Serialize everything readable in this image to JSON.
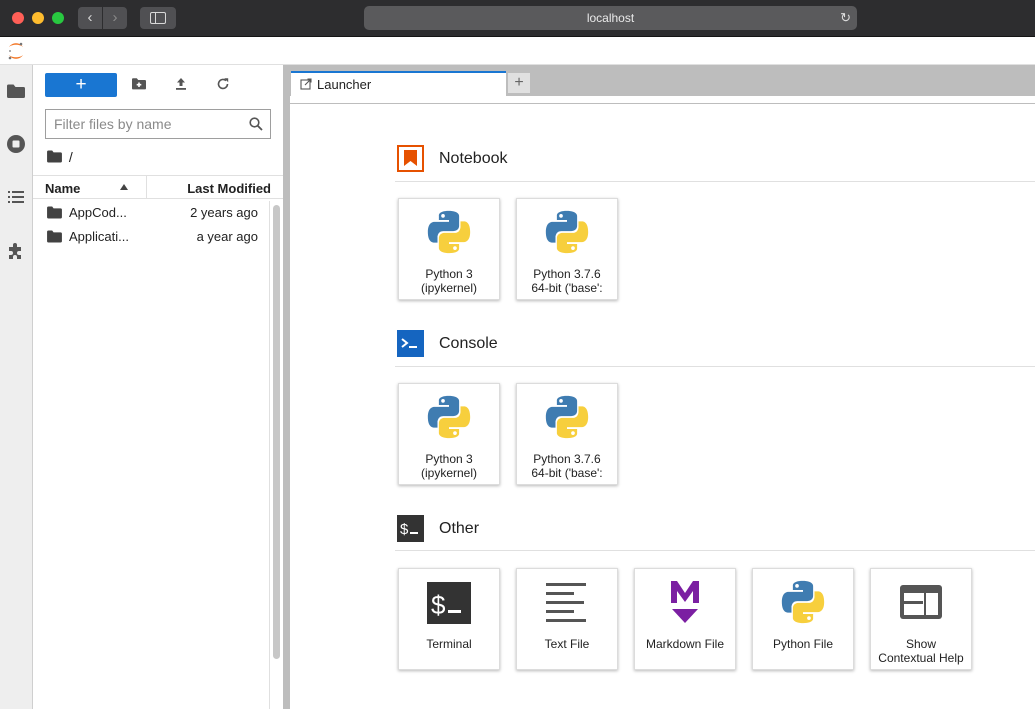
{
  "browser": {
    "url": "localhost",
    "colors": {
      "close": "#ff5f57",
      "minimize": "#febc2e",
      "zoom": "#28c840"
    }
  },
  "file_browser": {
    "new_button_label": "+",
    "filter_placeholder": "Filter files by name",
    "breadcrumb": "/",
    "columns": {
      "name": "Name",
      "modified": "Last Modified"
    },
    "files": [
      {
        "name": "AppCod...",
        "modified": "2 years ago",
        "icon": "folder-icon"
      },
      {
        "name": "Applicati...",
        "modified": "a year ago",
        "icon": "folder-icon"
      }
    ]
  },
  "tabs": [
    {
      "label": "Launcher",
      "icon": "launcher-tab-icon"
    }
  ],
  "new_tab_label": "+",
  "launcher": {
    "sections": [
      {
        "title": "Notebook",
        "icon": "notebook-icon",
        "items": [
          {
            "label": "Python 3\n(ipykernel)",
            "icon": "python-icon"
          },
          {
            "label": "Python 3.7.6\n64-bit ('base':",
            "icon": "python-icon"
          }
        ]
      },
      {
        "title": "Console",
        "icon": "console-icon",
        "items": [
          {
            "label": "Python 3\n(ipykernel)",
            "icon": "python-icon"
          },
          {
            "label": "Python 3.7.6\n64-bit ('base':",
            "icon": "python-icon"
          }
        ]
      },
      {
        "title": "Other",
        "icon": "terminal-section-icon",
        "items": [
          {
            "label": "Terminal",
            "icon": "terminal-icon"
          },
          {
            "label": "Text File",
            "icon": "text-file-icon"
          },
          {
            "label": "Markdown File",
            "icon": "markdown-icon"
          },
          {
            "label": "Python File",
            "icon": "python-icon"
          },
          {
            "label": "Show\nContextual Help",
            "icon": "contextual-help-icon"
          }
        ]
      }
    ]
  },
  "colors": {
    "accent": "#1976d2",
    "notebook_orange": "#e65100",
    "markdown_purple": "#7b1fa2",
    "python_blue": "#3776ab",
    "python_yellow": "#ffd43b"
  }
}
